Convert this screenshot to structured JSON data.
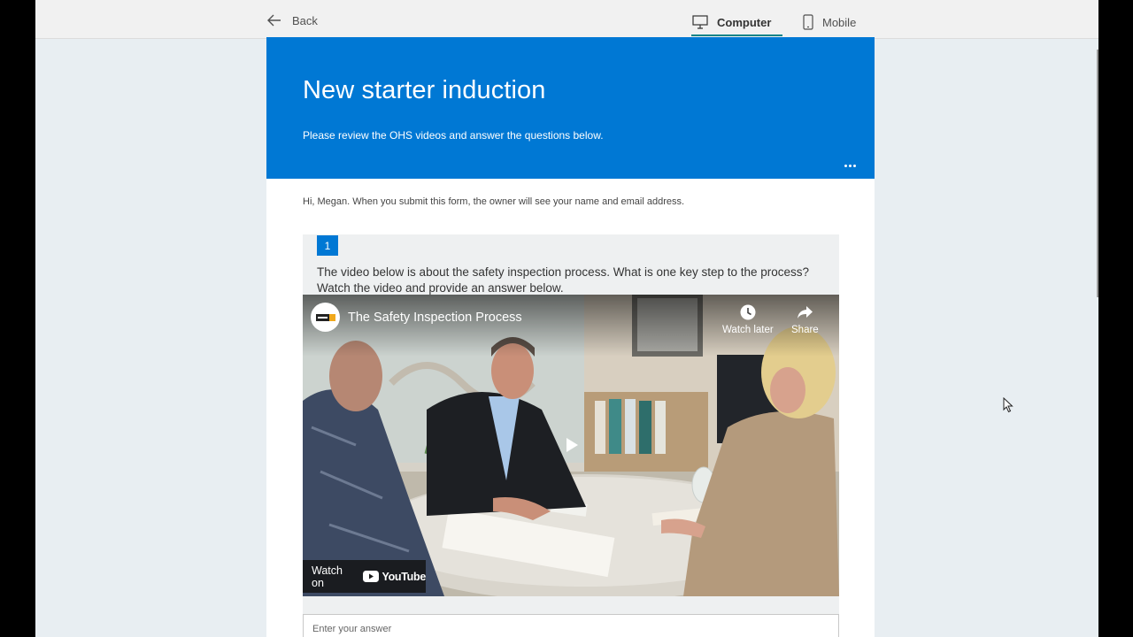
{
  "topbar": {
    "back_label": "Back",
    "tabs": [
      {
        "label": "Computer",
        "icon": "monitor-icon",
        "selected": true
      },
      {
        "label": "Mobile",
        "icon": "phone-icon",
        "selected": false
      }
    ],
    "accent": "#038387"
  },
  "form": {
    "title": "New starter induction",
    "subtitle": "Please review the OHS videos and answer the questions below.",
    "banner_color": "#0078d4",
    "notice": "Hi, Megan. When you submit this form, the owner will see your name and email address.",
    "more_icon": "ellipsis-icon"
  },
  "question": {
    "number": "1",
    "text": "The video below is about the safety inspection process. What is one key step to the process? Watch the video and provide an answer below.",
    "answer_placeholder": "Enter your answer"
  },
  "video": {
    "title": "The Safety Inspection Process",
    "watch_later_label": "Watch later",
    "share_label": "Share",
    "watch_on_label": "Watch on",
    "youtube_label": "YouTube",
    "icons": [
      "clock-icon",
      "share-arrow-icon",
      "play-icon",
      "youtube-logo-icon"
    ]
  }
}
